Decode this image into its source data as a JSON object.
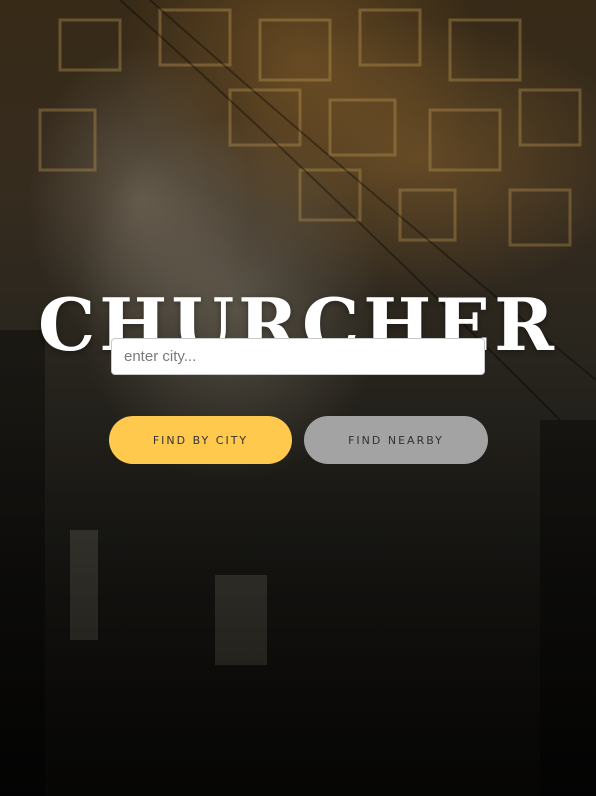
{
  "app": {
    "title": "CHURCHER"
  },
  "search": {
    "placeholder": "enter city...",
    "value": ""
  },
  "actions": {
    "find_by_city_label": "FIND BY CITY",
    "find_nearby_label": "FIND NEARBY"
  },
  "colors": {
    "primary_button": "#ffc94d",
    "secondary_button": "#a3a3a3",
    "title_text": "#ffffff"
  },
  "icons": {
    "background": "church-interior-image"
  }
}
